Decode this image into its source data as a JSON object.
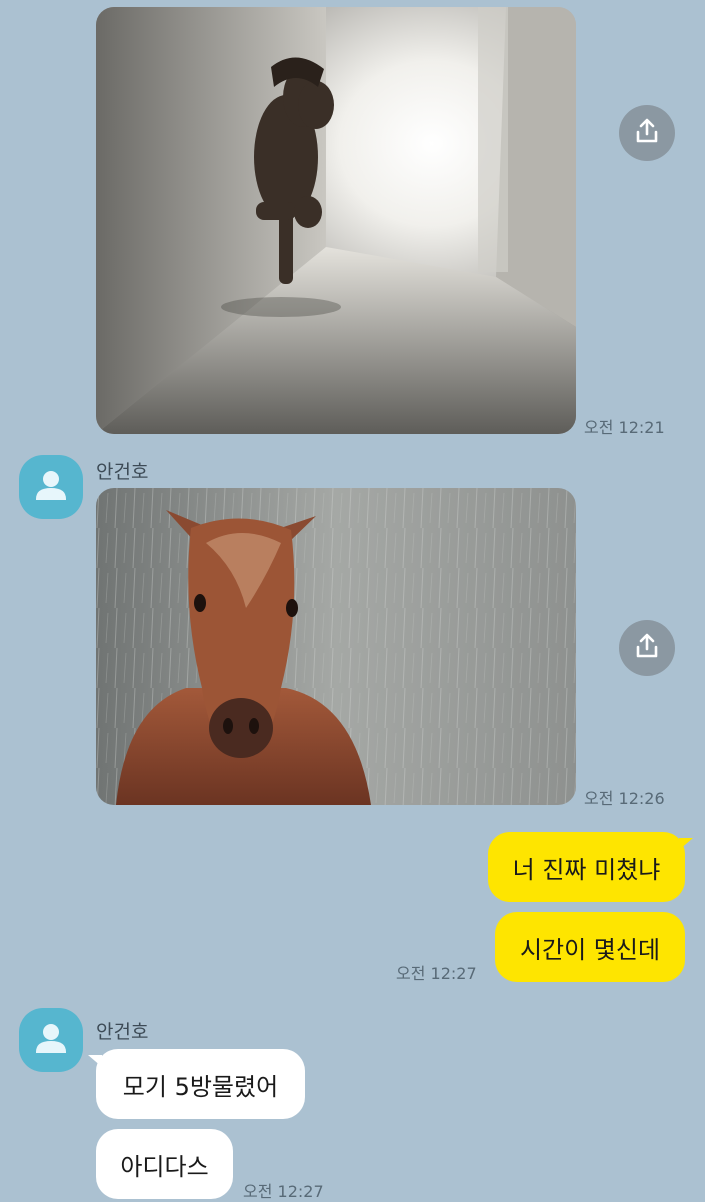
{
  "colors": {
    "chat_background": "#abc1d1",
    "my_bubble": "#fee500",
    "their_bubble": "#ffffff",
    "avatar": "#56b6cf",
    "share_button": "#8b98a2"
  },
  "messages": {
    "photo1": {
      "subject": "pony-in-hallway-photo",
      "time": "오전 12:21",
      "share_icon": "share-icon"
    },
    "photo2": {
      "sender": "안건호",
      "subject": "horse-in-rain-photo",
      "time": "오전 12:26",
      "share_icon": "share-icon"
    },
    "mine": {
      "texts": [
        "너 진짜 미쳤냐",
        "시간이 몇신데"
      ],
      "time": "오전 12:27"
    },
    "reply": {
      "sender": "안건호",
      "texts": [
        "모기 5방물렸어",
        "아디다스"
      ],
      "time": "오전 12:27"
    }
  }
}
